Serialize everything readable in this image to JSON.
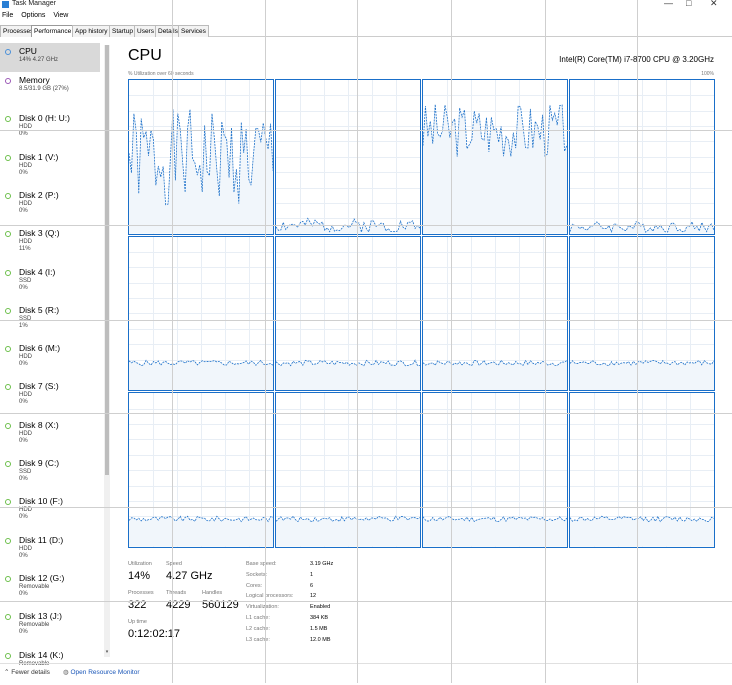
{
  "window": {
    "title": "Task Manager",
    "minimize": "—",
    "maximize": "□",
    "close": "✕"
  },
  "menu": [
    "File",
    "Options",
    "View"
  ],
  "tabs": [
    "Processes",
    "Performance",
    "App history",
    "Startup",
    "Users",
    "Details",
    "Services"
  ],
  "sidebar": {
    "items": [
      {
        "name": "CPU",
        "l1": "14%  4.27 GHz",
        "l2": "",
        "icon": "cpu"
      },
      {
        "name": "Memory",
        "l1": "8.5/31.9 GB (27%)",
        "l2": "",
        "icon": "memory"
      },
      {
        "name": "Disk 0 (H: U:)",
        "l1": "HDD",
        "l2": "0%",
        "icon": "disk"
      },
      {
        "name": "Disk 1 (V:)",
        "l1": "HDD",
        "l2": "0%",
        "icon": "disk"
      },
      {
        "name": "Disk 2 (P:)",
        "l1": "HDD",
        "l2": "0%",
        "icon": "disk"
      },
      {
        "name": "Disk 3 (Q:)",
        "l1": "HDD",
        "l2": "11%",
        "icon": "disk"
      },
      {
        "name": "Disk 4 (I:)",
        "l1": "SSD",
        "l2": "0%",
        "icon": "disk"
      },
      {
        "name": "Disk 5 (R:)",
        "l1": "SSD",
        "l2": "1%",
        "icon": "disk"
      },
      {
        "name": "Disk 6 (M:)",
        "l1": "HDD",
        "l2": "0%",
        "icon": "disk"
      },
      {
        "name": "Disk 7 (S:)",
        "l1": "HDD",
        "l2": "0%",
        "icon": "disk"
      },
      {
        "name": "Disk 8 (X:)",
        "l1": "HDD",
        "l2": "0%",
        "icon": "disk"
      },
      {
        "name": "Disk 9 (C:)",
        "l1": "SSD",
        "l2": "0%",
        "icon": "disk"
      },
      {
        "name": "Disk 10 (F:)",
        "l1": "HDD",
        "l2": "0%",
        "icon": "disk"
      },
      {
        "name": "Disk 11 (D:)",
        "l1": "HDD",
        "l2": "0%",
        "icon": "disk"
      },
      {
        "name": "Disk 12 (G:)",
        "l1": "Removable",
        "l2": "0%",
        "icon": "disk"
      },
      {
        "name": "Disk 13 (J:)",
        "l1": "Removable",
        "l2": "0%",
        "icon": "disk"
      },
      {
        "name": "Disk 14 (K:)",
        "l1": "Removable",
        "l2": "",
        "icon": "disk"
      }
    ]
  },
  "main": {
    "title": "CPU",
    "model": "Intel(R) Core(TM) i7-8700 CPU @ 3.20GHz",
    "caption": "% Utilization over 60 seconds",
    "max_label": "100%"
  },
  "stats": {
    "utilization_label": "Utilization",
    "utilization": "14%",
    "speed_label": "Speed",
    "speed": "4.27 GHz",
    "processes_label": "Processes",
    "processes": "322",
    "threads_label": "Threads",
    "threads": "4229",
    "handles_label": "Handles",
    "handles": "560129",
    "uptime_label": "Up time",
    "uptime": "0:12:02:17",
    "kv": [
      {
        "k": "Base speed:",
        "v": "3.19 GHz"
      },
      {
        "k": "Sockets:",
        "v": "1"
      },
      {
        "k": "Cores:",
        "v": "6"
      },
      {
        "k": "Logical processors:",
        "v": "12"
      },
      {
        "k": "Virtualization:",
        "v": "Enabled"
      },
      {
        "k": "L1 cache:",
        "v": "384 KB"
      },
      {
        "k": "L2 cache:",
        "v": "1.5 MB"
      },
      {
        "k": "L3 cache:",
        "v": "12.0 MB"
      }
    ]
  },
  "footer": {
    "fewer": "Fewer details",
    "orm": "Open Resource Monitor"
  },
  "colors": {
    "graph_line": "#1a6fc9",
    "graph_fill": "#f1f6fb"
  },
  "cores": [
    {
      "base": 0.55,
      "amp": 0.35,
      "seed": 1
    },
    {
      "base": 0.06,
      "amp": 0.05,
      "seed": 2
    },
    {
      "base": 0.75,
      "amp": 0.2,
      "seed": 3
    },
    {
      "base": 0.05,
      "amp": 0.04,
      "seed": 4
    },
    {
      "base": 0.2,
      "amp": 0.02,
      "seed": 5
    },
    {
      "base": 0.2,
      "amp": 0.02,
      "seed": 6
    },
    {
      "base": 0.2,
      "amp": 0.02,
      "seed": 7
    },
    {
      "base": 0.2,
      "amp": 0.02,
      "seed": 8
    },
    {
      "base": 0.2,
      "amp": 0.02,
      "seed": 9
    },
    {
      "base": 0.2,
      "amp": 0.02,
      "seed": 10
    },
    {
      "base": 0.2,
      "amp": 0.02,
      "seed": 11
    },
    {
      "base": 0.2,
      "amp": 0.02,
      "seed": 12
    }
  ]
}
